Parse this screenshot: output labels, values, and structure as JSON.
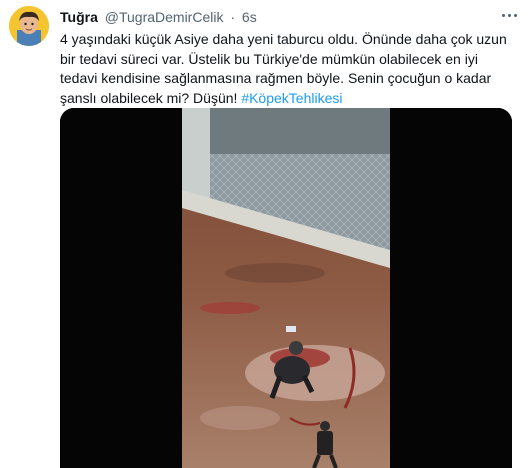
{
  "author": {
    "name": "Tuğra",
    "handle": "@TugraDemirCelik",
    "separator": "·",
    "time": "6s"
  },
  "tweet": {
    "text": "4 yaşındaki küçük Asiye daha yeni taburcu oldu. Önünde daha çok uzun bir tedavi süreci var. Üstelik bu Türkiye'de mümkün olabilecek en iyi tedavi kendisine sağlanmasına rağmen böyle. Senin çocuğun o kadar şanslı olabilecek mi? Düşün! ",
    "hashtag": "#KöpekTehlikesi"
  },
  "icons": {
    "avatar": "avatar-cartoon-icon",
    "more": "more-options-icon"
  },
  "colors": {
    "link": "#1d9bf0",
    "secondary_text": "#536471",
    "primary_text": "#0f1419"
  }
}
